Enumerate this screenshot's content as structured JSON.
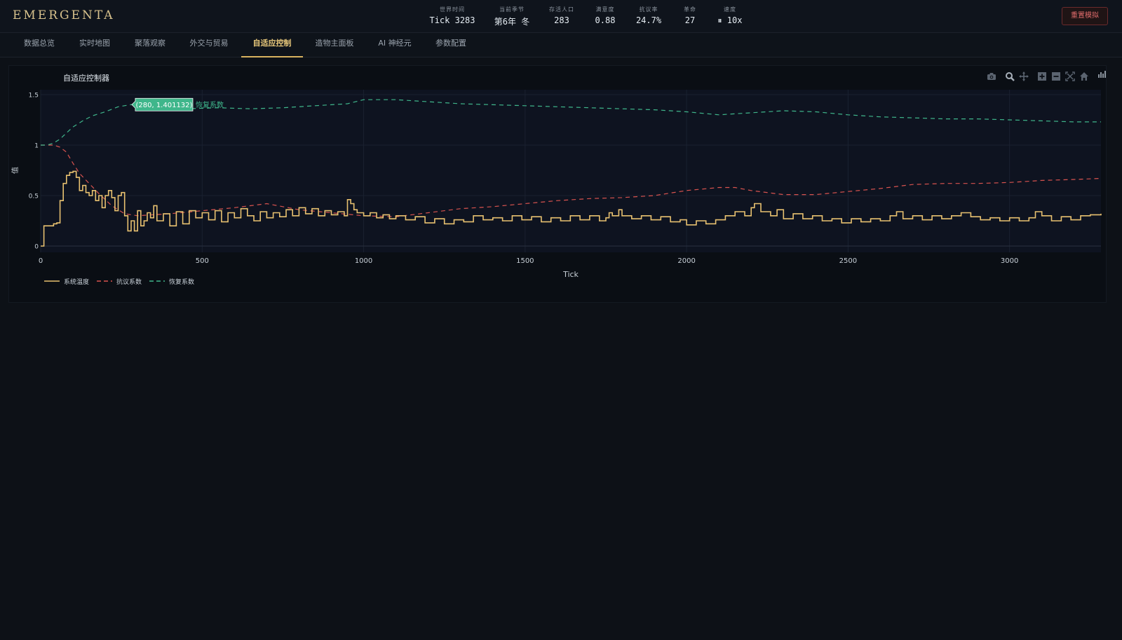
{
  "header": {
    "logo": "EMERGENTA",
    "stats": [
      {
        "label": "世界时间",
        "value": "Tick 3283"
      },
      {
        "label": "当前季节",
        "value": "第6年 冬"
      },
      {
        "label": "存活人口",
        "value": "283"
      },
      {
        "label": "满意度",
        "value": "0.88"
      },
      {
        "label": "抗议率",
        "value": "24.7%"
      },
      {
        "label": "革命",
        "value": "27"
      },
      {
        "label": "速度",
        "value": "⏸ 10x"
      }
    ],
    "reset_label": "重置模拟"
  },
  "tabs": [
    {
      "label": "数据总览"
    },
    {
      "label": "实时地图"
    },
    {
      "label": "聚落观察"
    },
    {
      "label": "外交与贸易"
    },
    {
      "label": "自适应控制"
    },
    {
      "label": "造物主面板"
    },
    {
      "label": "AI 神经元"
    },
    {
      "label": "参数配置"
    }
  ],
  "active_tab": 4,
  "panel": {
    "title": "自适应控制器",
    "toolbar": [
      "camera-icon",
      "zoom-icon",
      "pan-icon",
      "zoom-in-icon",
      "zoom-out-icon",
      "autoscale-icon",
      "home-icon",
      "plotly-logo-icon"
    ]
  },
  "colors": {
    "accent": "#e7c77a",
    "temperature": "#e8c170",
    "protest": "#d9534f",
    "recovery": "#3fb68b",
    "reset": "#e06c6c"
  },
  "chart_data": {
    "type": "line",
    "xlabel": "Tick",
    "ylabel": "值",
    "xlim": [
      0,
      3283
    ],
    "ylim": [
      0,
      1.5
    ],
    "x_ticks": [
      0,
      500,
      1000,
      1500,
      2000,
      2500,
      3000
    ],
    "y_ticks": [
      0,
      0.5,
      1,
      1.5
    ],
    "y_tick_labels": [
      "0",
      "0.5",
      "1",
      "1.5"
    ],
    "legend_position": "bottom-left",
    "tooltip": {
      "text": "(280, 1.401132)",
      "series": "恢复系数"
    },
    "series": [
      {
        "name": "系统温度",
        "style": "solid",
        "shape": "step",
        "points": [
          [
            0,
            0
          ],
          [
            10,
            0.2
          ],
          [
            40,
            0.22
          ],
          [
            50,
            0.23
          ],
          [
            60,
            0.45
          ],
          [
            70,
            0.62
          ],
          [
            80,
            0.7
          ],
          [
            90,
            0.73
          ],
          [
            100,
            0.74
          ],
          [
            110,
            0.68
          ],
          [
            120,
            0.55
          ],
          [
            130,
            0.6
          ],
          [
            140,
            0.53
          ],
          [
            150,
            0.5
          ],
          [
            160,
            0.55
          ],
          [
            170,
            0.45
          ],
          [
            180,
            0.5
          ],
          [
            190,
            0.38
          ],
          [
            200,
            0.5
          ],
          [
            210,
            0.55
          ],
          [
            220,
            0.48
          ],
          [
            230,
            0.35
          ],
          [
            240,
            0.5
          ],
          [
            250,
            0.53
          ],
          [
            260,
            0.3
          ],
          [
            270,
            0.15
          ],
          [
            280,
            0.25
          ],
          [
            290,
            0.15
          ],
          [
            300,
            0.35
          ],
          [
            310,
            0.2
          ],
          [
            320,
            0.25
          ],
          [
            330,
            0.33
          ],
          [
            340,
            0.28
          ],
          [
            350,
            0.4
          ],
          [
            360,
            0.25
          ],
          [
            380,
            0.32
          ],
          [
            400,
            0.2
          ],
          [
            420,
            0.34
          ],
          [
            440,
            0.22
          ],
          [
            460,
            0.35
          ],
          [
            480,
            0.28
          ],
          [
            500,
            0.33
          ],
          [
            520,
            0.26
          ],
          [
            540,
            0.35
          ],
          [
            560,
            0.24
          ],
          [
            580,
            0.33
          ],
          [
            600,
            0.28
          ],
          [
            620,
            0.37
          ],
          [
            640,
            0.3
          ],
          [
            660,
            0.25
          ],
          [
            680,
            0.34
          ],
          [
            700,
            0.28
          ],
          [
            720,
            0.33
          ],
          [
            740,
            0.29
          ],
          [
            760,
            0.36
          ],
          [
            780,
            0.3
          ],
          [
            800,
            0.38
          ],
          [
            820,
            0.32
          ],
          [
            840,
            0.37
          ],
          [
            860,
            0.3
          ],
          [
            880,
            0.35
          ],
          [
            900,
            0.31
          ],
          [
            920,
            0.34
          ],
          [
            940,
            0.3
          ],
          [
            950,
            0.46
          ],
          [
            960,
            0.42
          ],
          [
            970,
            0.36
          ],
          [
            980,
            0.33
          ],
          [
            1000,
            0.3
          ],
          [
            1020,
            0.33
          ],
          [
            1040,
            0.28
          ],
          [
            1060,
            0.31
          ],
          [
            1080,
            0.27
          ],
          [
            1100,
            0.3
          ],
          [
            1130,
            0.26
          ],
          [
            1160,
            0.29
          ],
          [
            1190,
            0.23
          ],
          [
            1220,
            0.27
          ],
          [
            1250,
            0.22
          ],
          [
            1280,
            0.26
          ],
          [
            1310,
            0.24
          ],
          [
            1340,
            0.3
          ],
          [
            1370,
            0.26
          ],
          [
            1400,
            0.28
          ],
          [
            1430,
            0.25
          ],
          [
            1460,
            0.3
          ],
          [
            1490,
            0.26
          ],
          [
            1520,
            0.29
          ],
          [
            1550,
            0.24
          ],
          [
            1580,
            0.28
          ],
          [
            1610,
            0.25
          ],
          [
            1640,
            0.3
          ],
          [
            1670,
            0.26
          ],
          [
            1700,
            0.3
          ],
          [
            1730,
            0.25
          ],
          [
            1750,
            0.28
          ],
          [
            1760,
            0.33
          ],
          [
            1770,
            0.3
          ],
          [
            1790,
            0.36
          ],
          [
            1800,
            0.3
          ],
          [
            1830,
            0.27
          ],
          [
            1860,
            0.3
          ],
          [
            1890,
            0.26
          ],
          [
            1920,
            0.29
          ],
          [
            1950,
            0.24
          ],
          [
            1980,
            0.26
          ],
          [
            2000,
            0.21
          ],
          [
            2030,
            0.25
          ],
          [
            2060,
            0.22
          ],
          [
            2090,
            0.26
          ],
          [
            2120,
            0.3
          ],
          [
            2150,
            0.34
          ],
          [
            2180,
            0.3
          ],
          [
            2200,
            0.38
          ],
          [
            2210,
            0.42
          ],
          [
            2230,
            0.34
          ],
          [
            2260,
            0.3
          ],
          [
            2280,
            0.36
          ],
          [
            2300,
            0.27
          ],
          [
            2330,
            0.32
          ],
          [
            2360,
            0.27
          ],
          [
            2390,
            0.3
          ],
          [
            2420,
            0.25
          ],
          [
            2450,
            0.27
          ],
          [
            2480,
            0.23
          ],
          [
            2510,
            0.27
          ],
          [
            2540,
            0.24
          ],
          [
            2570,
            0.27
          ],
          [
            2600,
            0.25
          ],
          [
            2630,
            0.3
          ],
          [
            2650,
            0.34
          ],
          [
            2670,
            0.27
          ],
          [
            2700,
            0.3
          ],
          [
            2730,
            0.26
          ],
          [
            2760,
            0.3
          ],
          [
            2790,
            0.27
          ],
          [
            2820,
            0.3
          ],
          [
            2850,
            0.33
          ],
          [
            2880,
            0.29
          ],
          [
            2910,
            0.26
          ],
          [
            2940,
            0.28
          ],
          [
            2970,
            0.25
          ],
          [
            3000,
            0.28
          ],
          [
            3030,
            0.25
          ],
          [
            3060,
            0.28
          ],
          [
            3080,
            0.34
          ],
          [
            3100,
            0.3
          ],
          [
            3130,
            0.25
          ],
          [
            3160,
            0.29
          ],
          [
            3190,
            0.26
          ],
          [
            3220,
            0.3
          ],
          [
            3250,
            0.31
          ],
          [
            3283,
            0.32
          ]
        ]
      },
      {
        "name": "抗议系数",
        "style": "dashed",
        "shape": "linear",
        "points": [
          [
            0,
            1.0
          ],
          [
            40,
            1.0
          ],
          [
            60,
            0.98
          ],
          [
            80,
            0.93
          ],
          [
            100,
            0.82
          ],
          [
            120,
            0.72
          ],
          [
            150,
            0.62
          ],
          [
            180,
            0.52
          ],
          [
            220,
            0.4
          ],
          [
            260,
            0.32
          ],
          [
            300,
            0.3
          ],
          [
            400,
            0.32
          ],
          [
            500,
            0.35
          ],
          [
            600,
            0.38
          ],
          [
            700,
            0.42
          ],
          [
            800,
            0.36
          ],
          [
            900,
            0.33
          ],
          [
            1000,
            0.3
          ],
          [
            1100,
            0.29
          ],
          [
            1200,
            0.33
          ],
          [
            1300,
            0.37
          ],
          [
            1400,
            0.39
          ],
          [
            1500,
            0.42
          ],
          [
            1600,
            0.45
          ],
          [
            1700,
            0.47
          ],
          [
            1800,
            0.48
          ],
          [
            1900,
            0.5
          ],
          [
            2000,
            0.55
          ],
          [
            2100,
            0.58
          ],
          [
            2150,
            0.58
          ],
          [
            2200,
            0.55
          ],
          [
            2300,
            0.51
          ],
          [
            2400,
            0.51
          ],
          [
            2500,
            0.54
          ],
          [
            2600,
            0.57
          ],
          [
            2700,
            0.61
          ],
          [
            2800,
            0.62
          ],
          [
            2900,
            0.62
          ],
          [
            3000,
            0.63
          ],
          [
            3100,
            0.65
          ],
          [
            3200,
            0.66
          ],
          [
            3283,
            0.67
          ]
        ]
      },
      {
        "name": "恢复系数",
        "style": "dashed",
        "shape": "linear",
        "points": [
          [
            0,
            1.0
          ],
          [
            20,
            1.0
          ],
          [
            40,
            1.02
          ],
          [
            60,
            1.06
          ],
          [
            80,
            1.12
          ],
          [
            100,
            1.18
          ],
          [
            130,
            1.24
          ],
          [
            160,
            1.29
          ],
          [
            200,
            1.33
          ],
          [
            240,
            1.38
          ],
          [
            280,
            1.401132
          ],
          [
            350,
            1.38
          ],
          [
            450,
            1.36
          ],
          [
            550,
            1.37
          ],
          [
            650,
            1.36
          ],
          [
            750,
            1.37
          ],
          [
            850,
            1.39
          ],
          [
            950,
            1.41
          ],
          [
            1000,
            1.45
          ],
          [
            1100,
            1.45
          ],
          [
            1200,
            1.43
          ],
          [
            1300,
            1.41
          ],
          [
            1400,
            1.4
          ],
          [
            1500,
            1.39
          ],
          [
            1600,
            1.38
          ],
          [
            1700,
            1.37
          ],
          [
            1800,
            1.36
          ],
          [
            1900,
            1.35
          ],
          [
            2000,
            1.33
          ],
          [
            2100,
            1.3
          ],
          [
            2200,
            1.32
          ],
          [
            2300,
            1.34
          ],
          [
            2400,
            1.33
          ],
          [
            2500,
            1.3
          ],
          [
            2600,
            1.28
          ],
          [
            2700,
            1.27
          ],
          [
            2800,
            1.26
          ],
          [
            2900,
            1.26
          ],
          [
            3000,
            1.25
          ],
          [
            3100,
            1.24
          ],
          [
            3200,
            1.23
          ],
          [
            3283,
            1.23
          ]
        ]
      }
    ]
  }
}
